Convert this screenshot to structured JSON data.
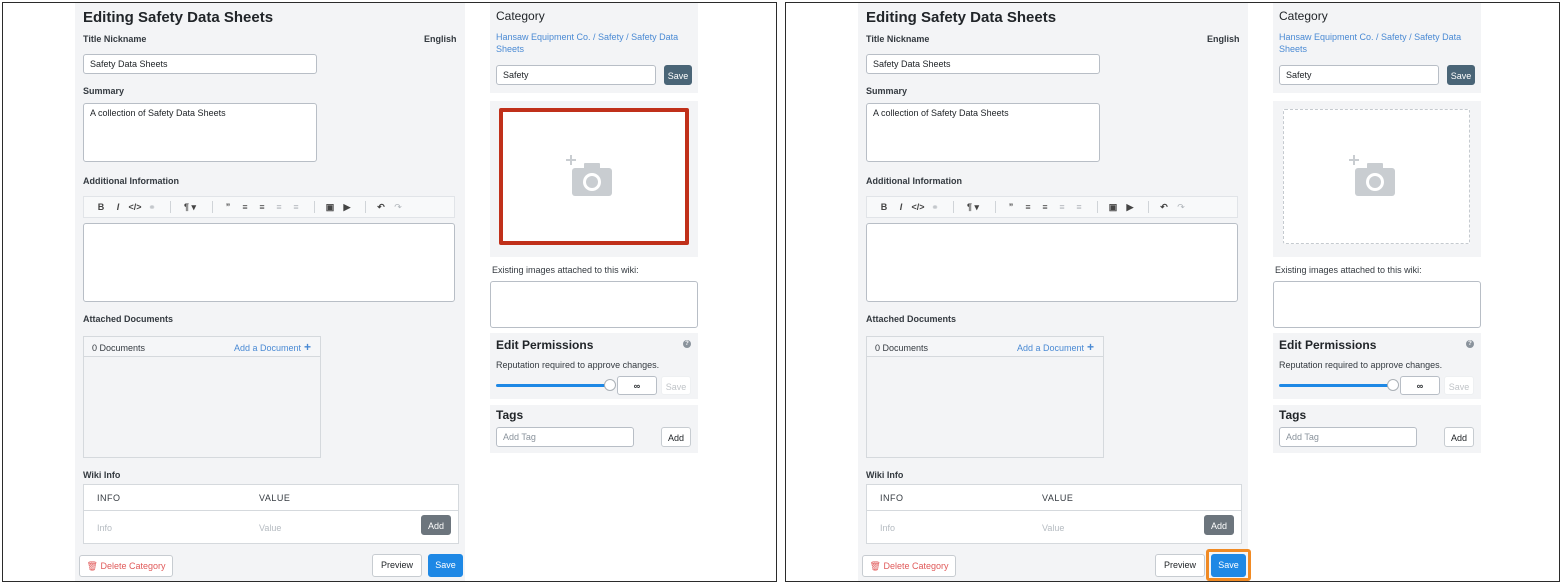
{
  "form": {
    "page_title": "Editing Safety Data Sheets",
    "title_nickname_label": "Title Nickname",
    "language": "English",
    "title_value": "Safety Data Sheets",
    "summary_label": "Summary",
    "summary_value": "A collection of Safety Data Sheets",
    "additional_info_label": "Additional Information",
    "editor_toolbar": [
      "bold-icon",
      "italic-icon",
      "code-icon",
      "link-icon",
      "paragraph-icon",
      "quote-icon",
      "bullet-list-icon",
      "numbered-list-icon",
      "outdent-icon",
      "indent-icon",
      "image-icon",
      "video-icon",
      "undo-icon",
      "redo-icon"
    ],
    "attached_documents_label": "Attached Documents",
    "documents_count": "0 Documents",
    "add_document_label": "Add a Document",
    "add_document_icon": "+",
    "wiki_info_label": "Wiki Info",
    "wiki_table": {
      "headers": [
        "INFO",
        "VALUE"
      ],
      "info_placeholder": "Info",
      "value_placeholder": "Value",
      "add_label": "Add"
    },
    "delete_label": "Delete Category",
    "preview_label": "Preview",
    "save_label": "Save"
  },
  "sidebar": {
    "category_heading": "Category",
    "category_breadcrumb": "Hansaw Equipment Co. / Safety / Safety Data Sheets",
    "category_value": "Safety",
    "category_save_label": "Save",
    "existing_images_label": "Existing images attached to this wiki:",
    "edit_permissions_heading": "Edit Permissions",
    "reputation_label": "Reputation required to approve changes.",
    "reputation_value": "∞",
    "reputation_level_fraction": 1.0,
    "permissions_save_label": "Save",
    "tags_heading": "Tags",
    "tag_placeholder": "Add Tag",
    "add_tag_label": "Add"
  },
  "highlights": {
    "step1_color": "#c0301a",
    "step2_color": "#f08a24"
  },
  "colors": {
    "primary_button": "#1e88e5",
    "category_save": "#4a6577",
    "delete_text": "#e05a5a",
    "link": "#4a8ad4"
  }
}
